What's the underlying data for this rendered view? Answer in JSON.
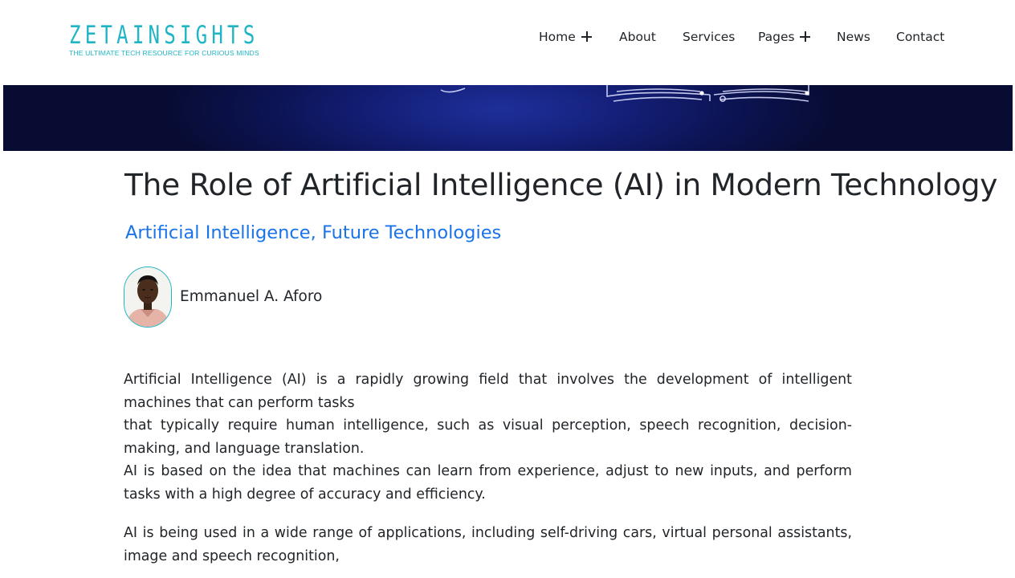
{
  "logo": {
    "wordmark": "ZETAINSIGHTS",
    "tagline": "THE ULTIMATE TECH RESOURCE FOR CURIOUS MINDS",
    "color": "#1fb5c4"
  },
  "nav": {
    "items": [
      {
        "label": "Home",
        "has_submenu": true
      },
      {
        "label": "About",
        "has_submenu": false
      },
      {
        "label": "Services",
        "has_submenu": false
      },
      {
        "label": "Pages",
        "has_submenu": true
      },
      {
        "label": "News",
        "has_submenu": false
      },
      {
        "label": "Contact",
        "has_submenu": false
      }
    ]
  },
  "article": {
    "title": "The Role of Artificial Intelligence (AI) in Modern Technology",
    "categories": [
      "Artificial Intelligence",
      "Future Technologies"
    ],
    "category_separator": ", ",
    "author": "Emmanuel A. Aforo",
    "paragraphs": [
      [
        "Artificial Intelligence (AI) is a rapidly growing field that involves the development of intelligent machines that can perform tasks",
        "that typically require human intelligence, such as visual perception, speech recognition, decision-making, and language translation.",
        "AI is based on the idea that machines can learn from experience, adjust to new inputs, and perform tasks with a high degree of accuracy and efficiency."
      ],
      [
        "AI is being used in a wide range of applications, including self-driving cars, virtual personal assistants, image and speech recognition,"
      ]
    ]
  },
  "colors": {
    "accent": "#1fb5c4",
    "link": "#1a73e8",
    "text": "#212529",
    "hero_dark": "#0c1352"
  }
}
